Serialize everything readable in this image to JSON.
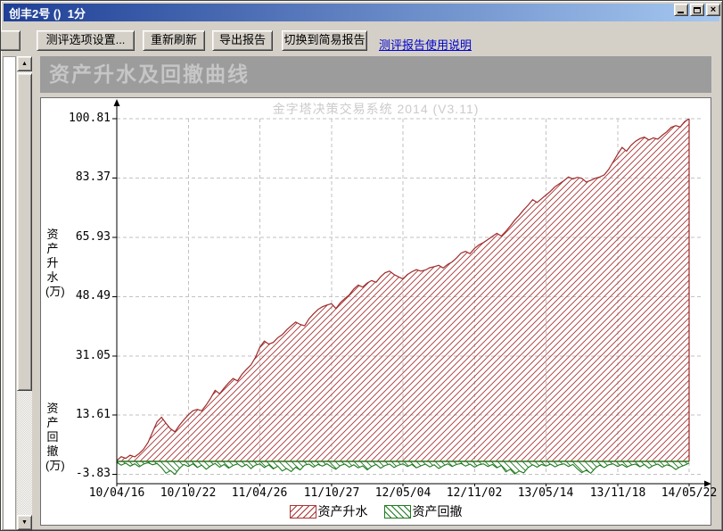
{
  "window": {
    "title": "创丰2号 ()  1分"
  },
  "toolbar": {
    "settings_button": "测评选项设置...",
    "refresh_button": "重新刷新",
    "export_button": "导出报告",
    "switch_button": "切换到简易报告",
    "help_link": "测评报告使用说明"
  },
  "section": {
    "title": "资产升水及回撤曲线"
  },
  "chart_data": {
    "type": "area",
    "title": "资产升水及回撤曲线",
    "watermark": "金字塔决策交易系统 2014 (V3.11)",
    "y_axis_label_upper": "资产升水(万)",
    "y_axis_label_lower": "资产回撤(万)",
    "ylim": [
      -3.83,
      100.81
    ],
    "y_ticks": [
      100.81,
      83.37,
      65.93,
      48.49,
      31.05,
      13.61,
      -3.83
    ],
    "x_ticks": [
      "10/04/16",
      "10/10/22",
      "11/04/26",
      "11/10/27",
      "12/05/04",
      "12/11/02",
      "13/05/14",
      "13/11/18",
      "14/05/22"
    ],
    "grid": true,
    "legend_position": "bottom",
    "series": [
      {
        "name": "资产升水",
        "color": "#a93434",
        "hatch": "/",
        "values": [
          0.2,
          1.4,
          0.9,
          1.8,
          1.3,
          2.3,
          3.6,
          5.6,
          8.6,
          11.6,
          13,
          11.2,
          9.6,
          8.7,
          10.6,
          12.2,
          13.7,
          14.9,
          15.3,
          14.9,
          16.6,
          18.6,
          20.9,
          19.9,
          21.6,
          23.1,
          24.4,
          23.7,
          25.6,
          27.1,
          28.4,
          30.6,
          33.6,
          35.4,
          34.5,
          35,
          36.4,
          37.3,
          38.7,
          39.9,
          41,
          40.3,
          39.9,
          42,
          43.4,
          44.7,
          45.5,
          46,
          46.4,
          45,
          46.7,
          47.9,
          49,
          50.7,
          51.9,
          51.3,
          52.5,
          53.2,
          52.7,
          54.3,
          55.5,
          56,
          55,
          54.3,
          53.7,
          55,
          55.8,
          56.4,
          56,
          56.3,
          57,
          57.3,
          57.7,
          56.9,
          58,
          58.7,
          59.9,
          61.3,
          61.8,
          61.1,
          62.7,
          63.7,
          64.4,
          65.3,
          66.2,
          67.1,
          66.3,
          67.7,
          69.3,
          71,
          72.4,
          74,
          75.4,
          77,
          76.2,
          77.3,
          78.4,
          79.5,
          80.8,
          81.7,
          82.6,
          83.7,
          83.1,
          83.6,
          83.3,
          82.2,
          82.7,
          83.3,
          83.7,
          84.3,
          85.9,
          88.1,
          90.4,
          92.4,
          91.3,
          93,
          94.2,
          95,
          95.4,
          94.6,
          95.2,
          94.8,
          96,
          97,
          98.3,
          98.8,
          98.4,
          100,
          100.81
        ]
      },
      {
        "name": "资产回撤",
        "color": "#1e7a1e",
        "hatch": "\\",
        "values": [
          -0.3,
          -1.1,
          -0.5,
          -1.4,
          -0.7,
          -1.6,
          -0.8,
          -0.4,
          -1,
          -0.6,
          -1.8,
          -3.5,
          -2.7,
          -3.8,
          -2.1,
          -0.9,
          -1.5,
          -0.7,
          -1.8,
          -1.1,
          -2.3,
          -1.3,
          -0.6,
          -1.7,
          -0.9,
          -2,
          -1.2,
          -0.7,
          -1.6,
          -0.9,
          -2.1,
          -1.1,
          -0.7,
          -1.8,
          -1,
          -2.2,
          -1.4,
          -2.8,
          -2.1,
          -3,
          -1.7,
          -2.5,
          -1.1,
          -0.8,
          -1.7,
          -0.9,
          -1.4,
          -0.7,
          -1.6,
          -2.3,
          -1.2,
          -0.8,
          -1.7,
          -1,
          -1.9,
          -1.3,
          -2.5,
          -1.5,
          -0.9,
          -2,
          -1.2,
          -0.8,
          -1.8,
          -1.1,
          -0.7,
          -1.5,
          -0.9,
          -1.9,
          -1.3,
          -0.8,
          -1.6,
          -1,
          -2.1,
          -1.3,
          -0.7,
          -1.5,
          -0.9,
          -0.6,
          -1.4,
          -0.8,
          -1.7,
          -1,
          -0.7,
          -1.5,
          -0.9,
          -1.9,
          -1.2,
          -3.1,
          -2.3,
          -3.7,
          -2.8,
          -3.4,
          -1.8,
          -1,
          -1.7,
          -0.9,
          -1.4,
          -0.8,
          -1.6,
          -1,
          -0.7,
          -1.5,
          -0.9,
          -2.2,
          -3.3,
          -2.6,
          -3.5,
          -2,
          -1.1,
          -1.8,
          -1,
          -0.7,
          -1.5,
          -0.9,
          -1.7,
          -1.1,
          -0.8,
          -1.6,
          -0.9,
          -2,
          -1.2,
          -0.8,
          -1.7,
          -1,
          -1.4,
          -2.4,
          -1.6,
          -1.1,
          -0.5
        ]
      }
    ]
  },
  "colors": {
    "window_bg": "#d4d0c8",
    "titlebar_left": "#1e3f96",
    "titlebar_right": "#a6c8f0",
    "section_header_bg": "#9c9c9c",
    "link": "#0000cc",
    "grid": "#c2c2c2",
    "accent_red": "#a93434",
    "accent_green": "#1e7a1e"
  }
}
